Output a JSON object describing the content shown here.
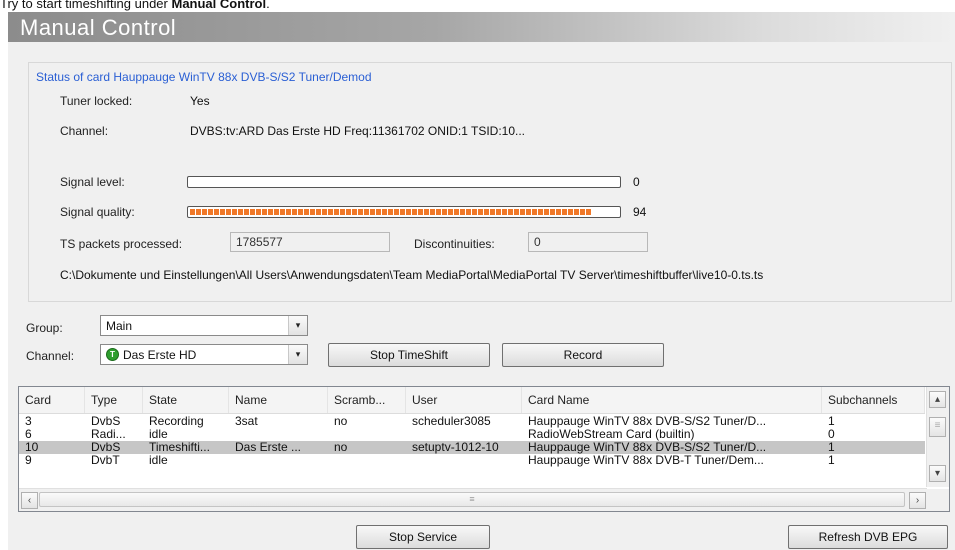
{
  "caption": {
    "prefix": "Try to start timeshifting under ",
    "bold": "Manual Control",
    "suffix": "."
  },
  "window": {
    "title": "Manual Control"
  },
  "status": {
    "title": "Status of card Hauppauge WinTV 88x DVB-S/S2 Tuner/Demod",
    "tuner_locked_label": "Tuner locked:",
    "tuner_locked_value": "Yes",
    "channel_label": "Channel:",
    "channel_value": "DVBS:tv:ARD Das Erste HD Freq:11361702 ONID:1 TSID:10...",
    "signal_level_label": "Signal level:",
    "signal_level_value": "0",
    "signal_level_percent": 0,
    "signal_quality_label": "Signal quality:",
    "signal_quality_value": "94",
    "signal_quality_percent": 94,
    "ts_packets_label": "TS packets processed:",
    "ts_packets_value": "1785577",
    "discontinuities_label": "Discontinuities:",
    "discontinuities_value": "0",
    "timeshift_path": "C:\\Dokumente und Einstellungen\\All Users\\Anwendungsdaten\\Team MediaPortal\\MediaPortal TV Server\\timeshiftbuffer\\live10-0.ts.ts"
  },
  "group": {
    "label": "Group:",
    "value": "Main"
  },
  "channel": {
    "label": "Channel:",
    "value": "Das Erste HD",
    "icon_letter": "T"
  },
  "buttons": {
    "stop_timeshift": "Stop TimeShift",
    "record": "Record",
    "stop_service": "Stop Service",
    "refresh_epg": "Refresh DVB EPG"
  },
  "table": {
    "columns": [
      "Card",
      "Type",
      "State",
      "Name",
      "Scramb...",
      "User",
      "Card Name",
      "Subchannels"
    ],
    "rows": [
      [
        "3",
        "DvbS",
        "Recording",
        "3sat",
        "no",
        "scheduler3085",
        "Hauppauge WinTV 88x DVB-S/S2 Tuner/D...",
        "1"
      ],
      [
        "6",
        "Radi...",
        "idle",
        "",
        "",
        "",
        "RadioWebStream Card (builtin)",
        "0"
      ],
      [
        "10",
        "DvbS",
        "Timeshifti...",
        "Das Erste ...",
        "no",
        "setuptv-1012-10",
        "Hauppauge WinTV 88x DVB-S/S2 Tuner/D...",
        "1"
      ],
      [
        "9",
        "DvbT",
        "idle",
        "",
        "",
        "",
        "Hauppauge WinTV 88x DVB-T Tuner/Dem...",
        "1"
      ]
    ],
    "selected_row": 2
  },
  "icons": {
    "dropdown": "▾",
    "scroll_up": "▴",
    "scroll_down": "▾",
    "scroll_left": "‹",
    "scroll_right": "›",
    "thumb_grip": "≡"
  },
  "colors": {
    "accent_blue": "#2a5fd4",
    "signal_bar": "#f07828",
    "channel_icon": "#2e9e2e"
  }
}
